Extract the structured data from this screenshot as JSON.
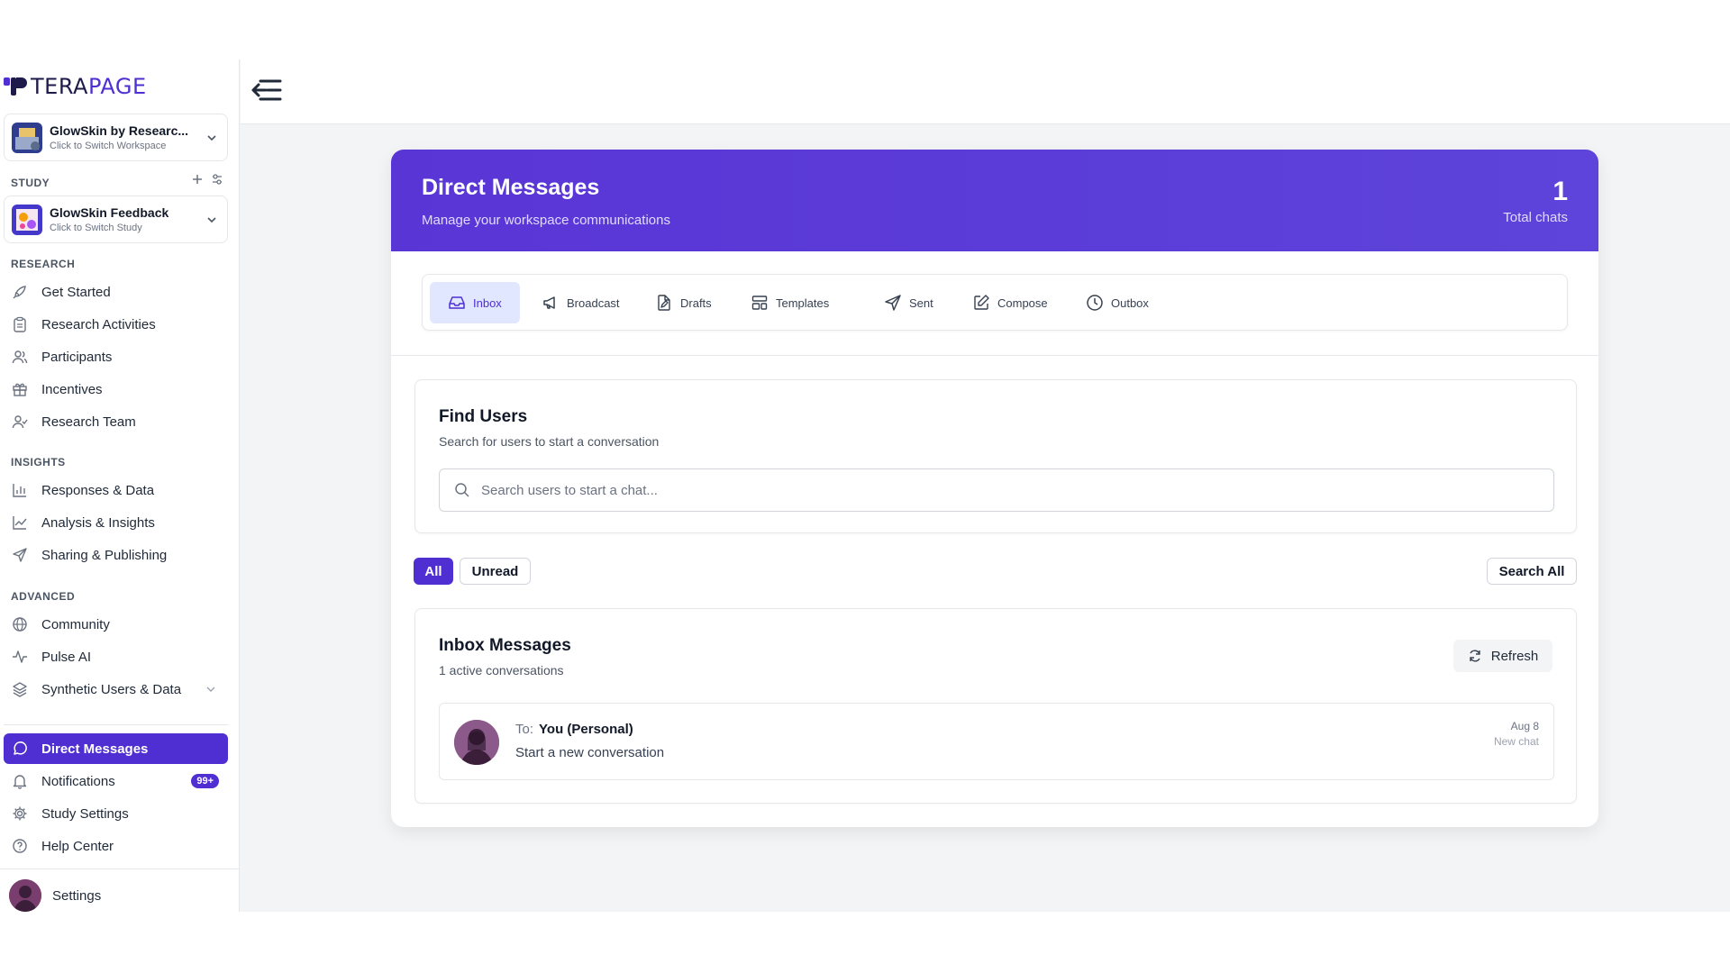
{
  "brand": {
    "name_part1": "TERA",
    "name_part2": "PAGE",
    "accent": "#4f2fd1"
  },
  "workspace": {
    "title": "GlowSkin by Researc...",
    "subtitle": "Click to Switch Workspace"
  },
  "study": {
    "section_label": "STUDY",
    "title": "GlowSkin Feedback",
    "subtitle": "Click to Switch Study"
  },
  "sidebar": {
    "research_label": "RESEARCH",
    "research_items": [
      "Get Started",
      "Research Activities",
      "Participants",
      "Incentives",
      "Research Team"
    ],
    "insights_label": "INSIGHTS",
    "insights_items": [
      "Responses & Data",
      "Analysis & Insights",
      "Sharing & Publishing"
    ],
    "advanced_label": "ADVANCED",
    "advanced_items": [
      "Community",
      "Pulse AI",
      "Synthetic Users & Data"
    ],
    "bottom_items": [
      "Direct Messages",
      "Notifications",
      "Study Settings",
      "Help Center"
    ],
    "notifications_badge": "99+",
    "user_settings": "Settings"
  },
  "header": {
    "title": "Direct Messages",
    "subtitle": "Manage your workspace communications",
    "count": "1",
    "count_label": "Total chats"
  },
  "tabs": [
    "Inbox",
    "Broadcast",
    "Drafts",
    "Templates",
    "Sent",
    "Compose",
    "Outbox"
  ],
  "find_users": {
    "title": "Find Users",
    "subtitle": "Search for users to start a conversation",
    "placeholder": "Search users to start a chat..."
  },
  "filters": {
    "all": "All",
    "unread": "Unread",
    "search_all": "Search All"
  },
  "inbox": {
    "title": "Inbox Messages",
    "subtitle": "1 active conversations",
    "refresh": "Refresh",
    "messages": [
      {
        "to_label": "To:",
        "recipient": "You (Personal)",
        "preview": "Start a new conversation",
        "date": "Aug 8",
        "tag": "New chat"
      }
    ]
  },
  "icons": {
    "get_started": "rocket-icon",
    "research_activities": "clipboard-icon",
    "participants": "users-icon",
    "incentives": "gift-icon",
    "research_team": "user-check-icon",
    "responses": "bar-chart-icon",
    "analysis": "line-chart-icon",
    "sharing": "send-icon",
    "community": "globe-icon",
    "pulse": "activity-icon",
    "synthetic": "layers-icon",
    "direct_messages": "message-circle-icon",
    "notifications": "bell-icon",
    "study_settings": "gear-icon",
    "help": "help-circle-icon"
  }
}
